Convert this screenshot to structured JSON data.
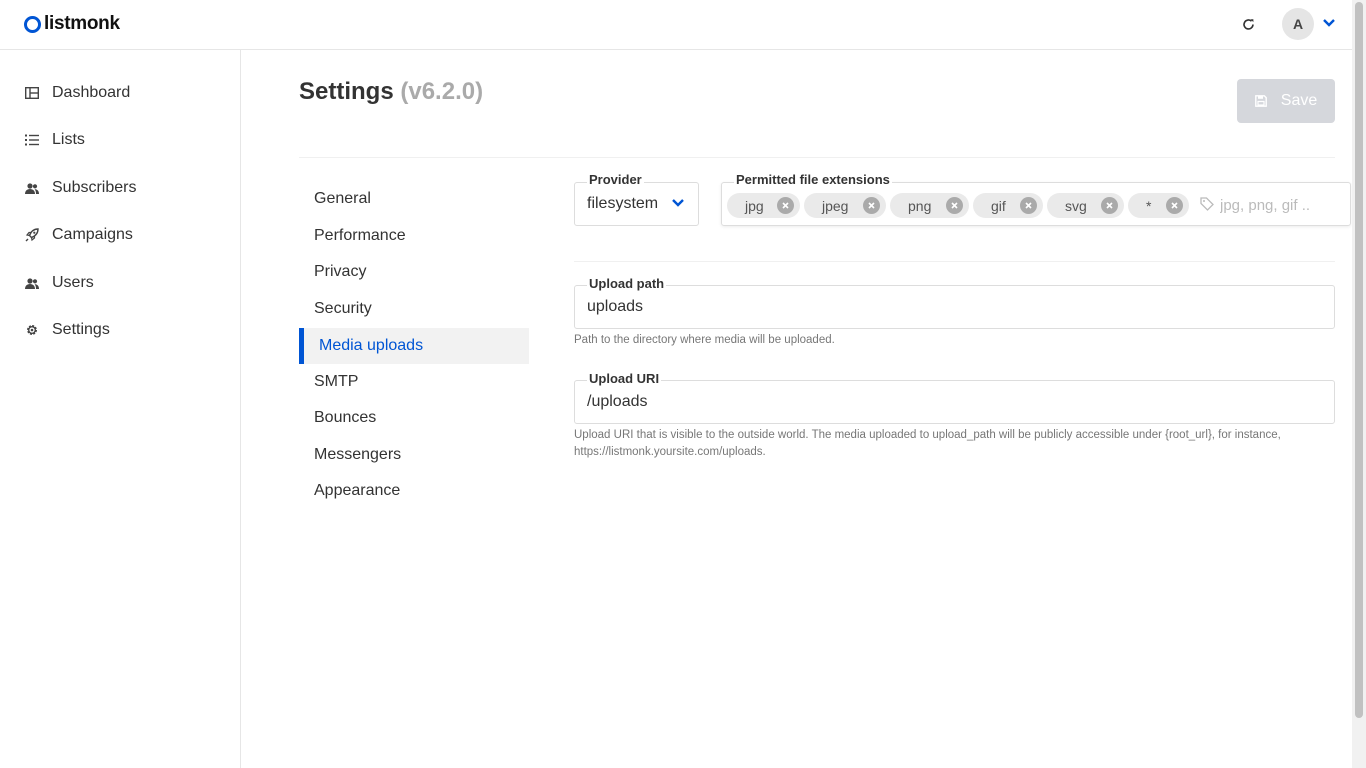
{
  "app": {
    "name": "listmonk"
  },
  "header": {
    "avatar_initial": "A"
  },
  "sidebar": {
    "items": [
      {
        "label": "Dashboard",
        "icon": "dashboard-icon"
      },
      {
        "label": "Lists",
        "icon": "list-icon"
      },
      {
        "label": "Subscribers",
        "icon": "users-icon"
      },
      {
        "label": "Campaigns",
        "icon": "rocket-icon"
      },
      {
        "label": "Users",
        "icon": "users-icon"
      },
      {
        "label": "Settings",
        "icon": "gear-icon"
      }
    ]
  },
  "page": {
    "title": "Settings",
    "version": "(v6.2.0)",
    "save_label": "Save"
  },
  "settings_nav": {
    "items": [
      "General",
      "Performance",
      "Privacy",
      "Security",
      "Media uploads",
      "SMTP",
      "Bounces",
      "Messengers",
      "Appearance"
    ],
    "active": "Media uploads"
  },
  "media": {
    "provider_label": "Provider",
    "provider_value": "filesystem",
    "extensions_label": "Permitted file extensions",
    "extensions": [
      "jpg",
      "jpeg",
      "png",
      "gif",
      "svg",
      "*"
    ],
    "extensions_placeholder": "jpg, png, gif ..",
    "upload_path_label": "Upload path",
    "upload_path_value": "uploads",
    "upload_path_help": "Path to the directory where media will be uploaded.",
    "upload_uri_label": "Upload URI",
    "upload_uri_value": "/uploads",
    "upload_uri_help": "Upload URI that is visible to the outside world. The media uploaded to upload_path will be publicly accessible under {root_url}, for instance, https://listmonk.yoursite.com/uploads."
  },
  "colors": {
    "brand": "#0055d4",
    "save_disabled": "#d5d7dc",
    "tag_bg": "#eaeaea"
  }
}
